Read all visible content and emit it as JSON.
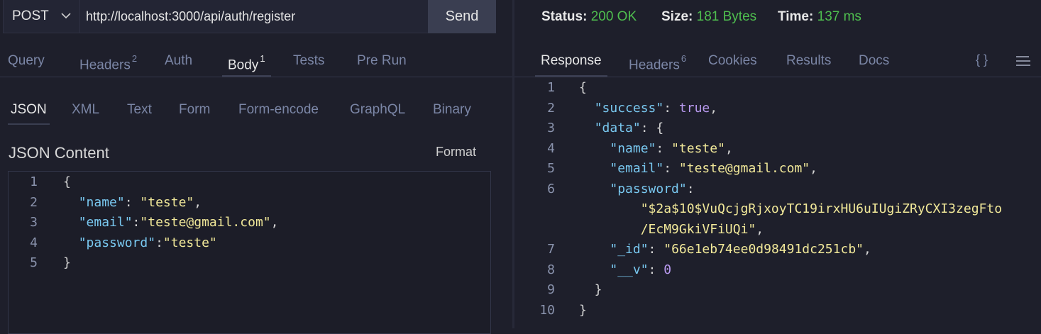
{
  "request": {
    "method": "POST",
    "url": "http://localhost:3000/api/auth/register",
    "send_label": "Send"
  },
  "request_tabs": [
    {
      "label": "Query",
      "badge": ""
    },
    {
      "label": "Headers",
      "badge": "2"
    },
    {
      "label": "Auth",
      "badge": ""
    },
    {
      "label": "Body",
      "badge": "1"
    },
    {
      "label": "Tests",
      "badge": ""
    },
    {
      "label": "Pre Run",
      "badge": ""
    }
  ],
  "body_tabs": [
    "JSON",
    "XML",
    "Text",
    "Form",
    "Form-encode",
    "GraphQL",
    "Binary"
  ],
  "body": {
    "title": "JSON Content",
    "format_label": "Format",
    "lines": [
      {
        "n": "1",
        "tokens": [
          [
            "p",
            "{"
          ]
        ]
      },
      {
        "n": "2",
        "tokens": [
          [
            "p",
            "  "
          ],
          [
            "k",
            "\"name\""
          ],
          [
            "p",
            ": "
          ],
          [
            "s",
            "\"teste\""
          ],
          [
            "p",
            ","
          ]
        ]
      },
      {
        "n": "3",
        "tokens": [
          [
            "p",
            "  "
          ],
          [
            "k",
            "\"email\""
          ],
          [
            "p",
            ":"
          ],
          [
            "s",
            "\"teste@gmail.com\""
          ],
          [
            "p",
            ","
          ]
        ]
      },
      {
        "n": "4",
        "tokens": [
          [
            "p",
            "  "
          ],
          [
            "k",
            "\"password\""
          ],
          [
            "p",
            ":"
          ],
          [
            "s",
            "\"teste\""
          ]
        ]
      },
      {
        "n": "5",
        "tokens": [
          [
            "p",
            "}"
          ]
        ]
      }
    ]
  },
  "response_status": {
    "status_label": "Status:",
    "status_value": "200 OK",
    "size_label": "Size:",
    "size_value": "181 Bytes",
    "time_label": "Time:",
    "time_value": "137 ms"
  },
  "response_tabs": [
    {
      "label": "Response",
      "badge": ""
    },
    {
      "label": "Headers",
      "badge": "6"
    },
    {
      "label": "Cookies",
      "badge": ""
    },
    {
      "label": "Results",
      "badge": ""
    },
    {
      "label": "Docs",
      "badge": ""
    }
  ],
  "response_icons": {
    "braces": "{ }",
    "menu": "≡"
  },
  "response": {
    "lines": [
      {
        "n": "1",
        "tokens": [
          [
            "p",
            "{"
          ]
        ]
      },
      {
        "n": "2",
        "tokens": [
          [
            "p",
            "  "
          ],
          [
            "k",
            "\"success\""
          ],
          [
            "p",
            ": "
          ],
          [
            "b",
            "true"
          ],
          [
            "p",
            ","
          ]
        ]
      },
      {
        "n": "3",
        "tokens": [
          [
            "p",
            "  "
          ],
          [
            "k",
            "\"data\""
          ],
          [
            "p",
            ": {"
          ]
        ]
      },
      {
        "n": "4",
        "tokens": [
          [
            "p",
            "    "
          ],
          [
            "k",
            "\"name\""
          ],
          [
            "p",
            ": "
          ],
          [
            "s",
            "\"teste\""
          ],
          [
            "p",
            ","
          ]
        ]
      },
      {
        "n": "5",
        "tokens": [
          [
            "p",
            "    "
          ],
          [
            "k",
            "\"email\""
          ],
          [
            "p",
            ": "
          ],
          [
            "s",
            "\"teste@gmail.com\""
          ],
          [
            "p",
            ","
          ]
        ]
      },
      {
        "n": "6",
        "tokens": [
          [
            "p",
            "    "
          ],
          [
            "k",
            "\"password\""
          ],
          [
            "p",
            ":"
          ]
        ]
      },
      {
        "n": "",
        "tokens": [
          [
            "p",
            "        "
          ],
          [
            "s",
            "\"$2a$10$VuQcjgRjxoyTC19irxHU6uIUgiZRyCXI3zegFto"
          ]
        ]
      },
      {
        "n": "",
        "tokens": [
          [
            "p",
            "        "
          ],
          [
            "s",
            "/EcM9GkiVFiUQi\""
          ],
          [
            "p",
            ","
          ]
        ]
      },
      {
        "n": "7",
        "tokens": [
          [
            "p",
            "    "
          ],
          [
            "k",
            "\"_id\""
          ],
          [
            "p",
            ": "
          ],
          [
            "s",
            "\"66e1eb74ee0d98491dc251cb\""
          ],
          [
            "p",
            ","
          ]
        ]
      },
      {
        "n": "8",
        "tokens": [
          [
            "p",
            "    "
          ],
          [
            "k",
            "\"__v\""
          ],
          [
            "p",
            ": "
          ],
          [
            "b",
            "0"
          ]
        ]
      },
      {
        "n": "9",
        "tokens": [
          [
            "p",
            "  }"
          ]
        ]
      },
      {
        "n": "10",
        "tokens": [
          [
            "p",
            "}"
          ]
        ]
      }
    ]
  }
}
